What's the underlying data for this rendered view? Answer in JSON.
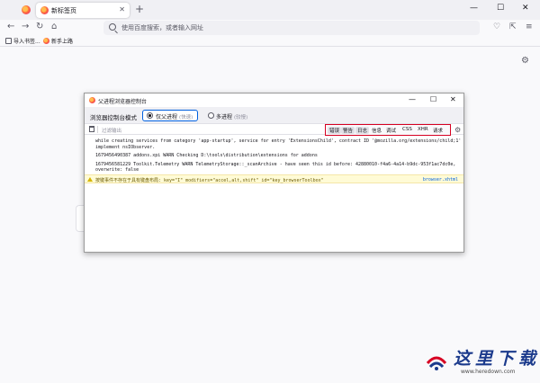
{
  "browser": {
    "tab": {
      "title": "新标签页",
      "close": "✕"
    },
    "new_tab": "+",
    "window_controls": {
      "minimize": "—",
      "maximize": "☐",
      "close": "✕"
    },
    "nav": {
      "back": "←",
      "forward": "→",
      "reload": "↻",
      "home": "⌂"
    },
    "url_placeholder": "使用百度搜索，或者输入网址",
    "right_icons": {
      "pocket": "♡",
      "extensions": "⇱",
      "menu": "≡"
    },
    "bookmarks": [
      {
        "label": "导入书签..."
      },
      {
        "label": "新手上路"
      }
    ],
    "page_settings": "⚙"
  },
  "console": {
    "title": "父进程浏览器控制台",
    "window_controls": {
      "minimize": "—",
      "maximize": "☐",
      "close": "✕"
    },
    "mode_label": "浏览器控制台模式",
    "modes": [
      {
        "label": "仅父进程",
        "sub": "(快速)",
        "selected": true
      },
      {
        "label": "多进程",
        "sub": "(较慢)",
        "selected": false
      }
    ],
    "filter_placeholder": "过滤输出",
    "levels": [
      {
        "label": "错误",
        "active": true
      },
      {
        "label": "警告",
        "active": true
      },
      {
        "label": "日志",
        "active": true
      },
      {
        "label": "信息",
        "active": false
      },
      {
        "label": "调试",
        "active": false
      },
      {
        "label": "CSS",
        "active": false
      },
      {
        "label": "XHR",
        "active": false
      },
      {
        "label": "请求",
        "active": false
      }
    ],
    "settings_icon": "⚙",
    "log_lines": [
      "while creating services from category 'app-startup', service for entry 'ExtensionsChild', contract ID '@mozilla.org/extensions/child;1' does not",
      "implement nsIObserver.",
      "1679456490387     addons.xpi        WARN     Checking D:\\tools\\distribution\\extensions for addons",
      "1679456581229     Toolkit.Telemetry        WARN     TelemetryStorage::_scanArchive - have seen this id before: 42880010-f4a6-4a14-b9dc-953f1ac7dc0e,",
      "overwrite: false"
    ],
    "warning": {
      "text": "按键事件不存在于具有键盘布局: key=\"I\" modifiers=\"accel,alt,shift\" id=\"key_browserToolbox\"",
      "source": "browser.xhtml"
    }
  },
  "watermark": {
    "text": "这里下载",
    "url": "www.heredown.com"
  }
}
